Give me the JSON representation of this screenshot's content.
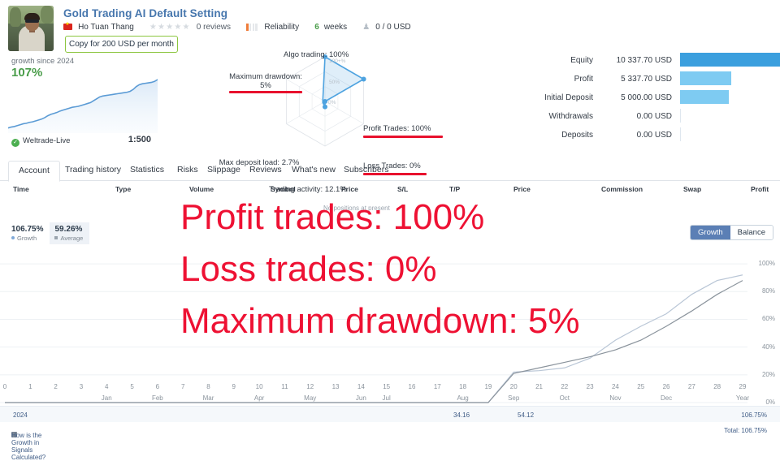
{
  "header": {
    "title": "Gold Trading AI Default Setting",
    "author": "Ho Tuan Thang",
    "flag_icon": "vietnam-flag-icon",
    "stars": "★★★★★",
    "reviews": "0 reviews",
    "reliability_label": "Reliability",
    "reliability_filled": 1,
    "reliability_total": 4,
    "weeks_value": "6",
    "weeks_label": "weeks",
    "subscribers_icon": "subscribers-icon",
    "subscribers_value": "0 / 0 USD",
    "copy_button": "Copy for 200 USD per month",
    "accent_brand": "#4676ad",
    "accent_green": "#8cc63f"
  },
  "growth_panel": {
    "label": "growth since 2024",
    "value": "107%",
    "broker": "Weltrade-Live",
    "broker_verified_icon": "check-circle-icon",
    "leverage": "1:500"
  },
  "radar": {
    "axes": [
      {
        "name": "algo-trading",
        "label": "Algo trading: 100%",
        "value": 100,
        "highlighted": false
      },
      {
        "name": "profit-trades",
        "label": "Profit Trades: 100%",
        "value": 100,
        "highlighted": true
      },
      {
        "name": "loss-trades",
        "label": "Loss Trades: 0%",
        "value": 0,
        "highlighted": true
      },
      {
        "name": "trading-activity",
        "label": "Trading activity: 12.1%",
        "value": 12.1,
        "highlighted": false
      },
      {
        "name": "max-deposit-load",
        "label": "Max deposit load: 2.7%",
        "value": 2.7,
        "highlighted": false
      },
      {
        "name": "maximum-drawdown",
        "label": "Maximum drawdown: 5%",
        "value": 5,
        "highlighted": true
      }
    ],
    "scale_labels": [
      "100+%",
      "50%",
      "0%"
    ],
    "highlight_color": "#e8112d",
    "series_color": "#4ea3e0"
  },
  "account_bars": {
    "rows": [
      {
        "name": "Equity",
        "value": "10 337.70 USD",
        "pct": 100,
        "color": "#3b9fde"
      },
      {
        "name": "Profit",
        "value": "5 337.70 USD",
        "pct": 51.6,
        "color": "#7ecbf2"
      },
      {
        "name": "Initial Deposit",
        "value": "5 000.00 USD",
        "pct": 48.4,
        "color": "#7ecbf2"
      },
      {
        "name": "Withdrawals",
        "value": "0.00 USD",
        "pct": 0,
        "color": "#7ecbf2"
      },
      {
        "name": "Deposits",
        "value": "0.00 USD",
        "pct": 0,
        "color": "#7ecbf2"
      }
    ]
  },
  "tabs": [
    {
      "label": "Account",
      "active": true
    },
    {
      "label": "Trading history",
      "active": false
    },
    {
      "label": "Statistics",
      "active": false
    },
    {
      "label": "Risks",
      "active": false
    },
    {
      "label": "Slippage",
      "active": false
    },
    {
      "label": "Reviews",
      "active": false
    },
    {
      "label": "What's new",
      "active": false
    },
    {
      "label": "Subscribers",
      "active": false
    }
  ],
  "positions_table": {
    "columns": [
      "Time",
      "Type",
      "Volume",
      "Symbol",
      "Price",
      "S/L",
      "T/P",
      "Price",
      "Commission",
      "Swap",
      "Profit"
    ],
    "empty_message": "No positions at present"
  },
  "chart_legend": {
    "growth_value": "106.75%",
    "growth_label": "Growth",
    "average_value": "59.26%",
    "average_label": "Average",
    "toggle": [
      {
        "label": "Growth",
        "active": true
      },
      {
        "label": "Balance",
        "active": false
      }
    ]
  },
  "footer": {
    "year": "2024",
    "col1": "34.16",
    "col2": "54.12",
    "year_total": "106.75%",
    "calc_link": "How is the Growth in Signals Calculated?",
    "calc_icon": "info-book-icon",
    "total": "Total: 106.75%"
  },
  "overlay": {
    "line1": "Profit trades: 100%",
    "line2": "Loss trades: 0%",
    "line3": "Maximum drawdown: 5%",
    "color": "#ee1133"
  },
  "chart_data": {
    "type": "line",
    "title": "Growth",
    "xlabel": "",
    "ylabel": "",
    "ylim": [
      0,
      110
    ],
    "grid": true,
    "legend_position": "top-left",
    "yticks": [
      "0%",
      "20%",
      "40%",
      "60%",
      "80%",
      "100%"
    ],
    "ytick_values": [
      0,
      20,
      40,
      60,
      80,
      100
    ],
    "x": [
      0,
      1,
      2,
      3,
      4,
      5,
      6,
      7,
      8,
      9,
      10,
      11,
      12,
      13,
      14,
      15,
      16,
      17,
      18,
      19,
      20,
      21,
      22,
      23,
      24,
      25,
      26,
      27,
      28,
      29
    ],
    "xtick_labels": [
      "0",
      "1",
      "2",
      "3",
      "4",
      "5",
      "6",
      "7",
      "8",
      "9",
      "10",
      "11",
      "12",
      "13",
      "14",
      "15",
      "16",
      "17",
      "18",
      "19",
      "20",
      "21",
      "22",
      "23",
      "24",
      "25",
      "26",
      "27",
      "28",
      "29"
    ],
    "month_labels": [
      {
        "label": "Jan",
        "at": 4
      },
      {
        "label": "Feb",
        "at": 6
      },
      {
        "label": "Mar",
        "at": 8
      },
      {
        "label": "Apr",
        "at": 10
      },
      {
        "label": "May",
        "at": 12
      },
      {
        "label": "Jun",
        "at": 14
      },
      {
        "label": "Jul",
        "at": 15
      },
      {
        "label": "Aug",
        "at": 18
      },
      {
        "label": "Sep",
        "at": 20
      },
      {
        "label": "Oct",
        "at": 22
      },
      {
        "label": "Nov",
        "at": 24
      },
      {
        "label": "Dec",
        "at": 26
      },
      {
        "label": "Year",
        "at": 29
      }
    ],
    "series": [
      {
        "name": "Growth",
        "color": "#b9c6d6",
        "values": [
          0,
          0,
          0,
          0,
          0,
          0,
          0,
          0,
          0,
          0,
          0,
          0,
          0,
          0,
          0,
          0,
          0,
          0,
          0,
          0,
          22,
          23,
          25,
          32,
          45,
          55,
          64,
          78,
          88,
          92
        ]
      },
      {
        "name": "Average",
        "color": "#8a939c",
        "values": [
          0,
          0,
          0,
          0,
          0,
          0,
          0,
          0,
          0,
          0,
          0,
          0,
          0,
          0,
          0,
          0,
          0,
          0,
          0,
          0,
          21,
          25,
          29,
          33,
          38,
          45,
          55,
          66,
          78,
          88
        ]
      }
    ]
  },
  "sparkline": {
    "type": "area",
    "color": "#5b9bd5",
    "values": [
      4,
      6,
      7,
      9,
      11,
      13,
      14,
      16,
      17,
      19,
      21,
      23,
      26,
      30,
      33,
      35,
      37,
      40,
      42,
      44,
      46,
      48,
      49,
      50,
      52,
      54,
      56,
      58,
      62,
      66,
      70,
      72,
      73,
      74,
      75,
      76,
      77,
      78,
      79,
      80,
      82,
      86,
      92,
      96,
      98,
      99,
      100,
      101,
      103,
      107
    ]
  }
}
